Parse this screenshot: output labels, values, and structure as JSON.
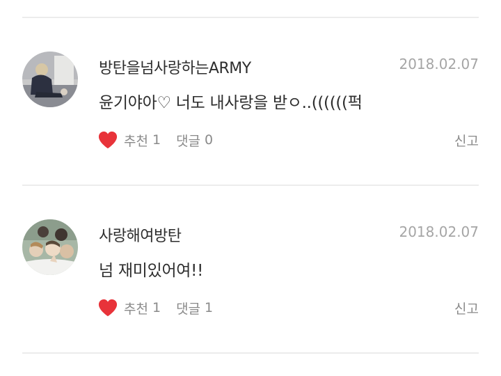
{
  "comments": [
    {
      "username": "방탄을넘사랑하는ARMY",
      "date": "2018.02.07",
      "text": "윤기야아♡ 너도 내사랑을 받ㅇ..((((((퍽",
      "like_label": "추천",
      "like_count": "1",
      "reply_label": "댓글",
      "reply_count": "0",
      "report_label": "신고",
      "avatar_icon": "avatar-photo-icon"
    },
    {
      "username": "사랑해여방탄",
      "date": "2018.02.07",
      "text": "넘 재미있어여!!",
      "like_label": "추천",
      "like_count": "1",
      "reply_label": "댓글",
      "reply_count": "1",
      "report_label": "신고",
      "avatar_icon": "avatar-photo-icon"
    }
  ],
  "colors": {
    "heart": "#e8333a",
    "divider": "#ececec",
    "date": "#a5a5a5",
    "meta": "#8a8a8a"
  }
}
